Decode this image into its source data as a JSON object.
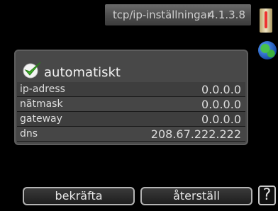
{
  "header": {
    "title": "tcp/ip-inställningar",
    "code": "4.1.3.8"
  },
  "icons": {
    "thermometer": "thermometer-icon",
    "globe": "globe-icon",
    "check": "checkmark-icon"
  },
  "panel": {
    "auto_label": "automatiskt",
    "auto_checked": true,
    "rows": [
      {
        "label": "ip-adress",
        "value": "0.0.0.0"
      },
      {
        "label": "nätmask",
        "value": "0.0.0.0"
      },
      {
        "label": "gateway",
        "value": "0.0.0.0"
      },
      {
        "label": "dns",
        "value": "208.67.222.222"
      }
    ]
  },
  "buttons": {
    "confirm_label": "bekräfta",
    "reset_label": "återställ",
    "help_label": "?"
  },
  "colors": {
    "panel_bg": "#484848",
    "header_bg": "#5a5a5a",
    "check_green": "#3fae2a"
  }
}
